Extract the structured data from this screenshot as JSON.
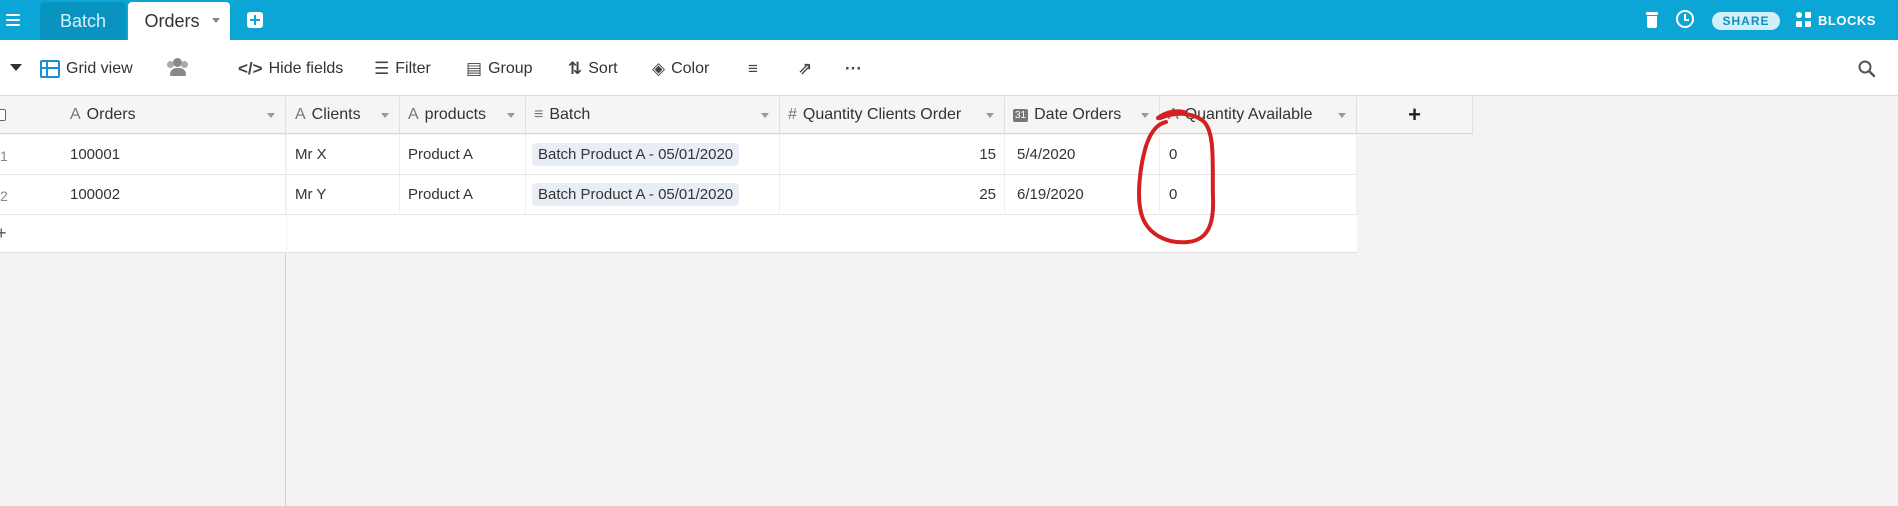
{
  "tabs": [
    {
      "label": "Batch"
    },
    {
      "label": "Orders"
    }
  ],
  "header_actions": {
    "share_label": "SHARE",
    "blocks_label": "BLOCKS"
  },
  "toolbar": {
    "view_name": "Grid view",
    "hide_fields": "Hide fields",
    "filter": "Filter",
    "group": "Group",
    "sort": "Sort",
    "color": "Color",
    "more": "···"
  },
  "table": {
    "primary_column": {
      "name": "Orders",
      "icon": "A"
    },
    "columns": [
      {
        "name": "Clients",
        "icon": "A"
      },
      {
        "name": "products",
        "icon": "A"
      },
      {
        "name": "Batch",
        "icon": "≡"
      },
      {
        "name": "Quantity Clients Order",
        "icon": "#"
      },
      {
        "name": "Date Orders",
        "icon": "31"
      },
      {
        "name": "Quantity Available",
        "icon": "A"
      }
    ],
    "rows": [
      {
        "num": "1",
        "order": "100001",
        "client": "Mr X",
        "product": "Product A",
        "batch": "Batch Product A - 05/01/2020",
        "qty": "15",
        "date": "5/4/2020",
        "available": "0"
      },
      {
        "num": "2",
        "order": "100002",
        "client": "Mr Y",
        "product": "Product A",
        "batch": "Batch Product A - 05/01/2020",
        "qty": "25",
        "date": "6/19/2020",
        "available": "0"
      }
    ],
    "add_row": "+",
    "add_column": "+"
  },
  "colors": {
    "topbar": "#0ba6d6",
    "annotation": "#d42020"
  }
}
